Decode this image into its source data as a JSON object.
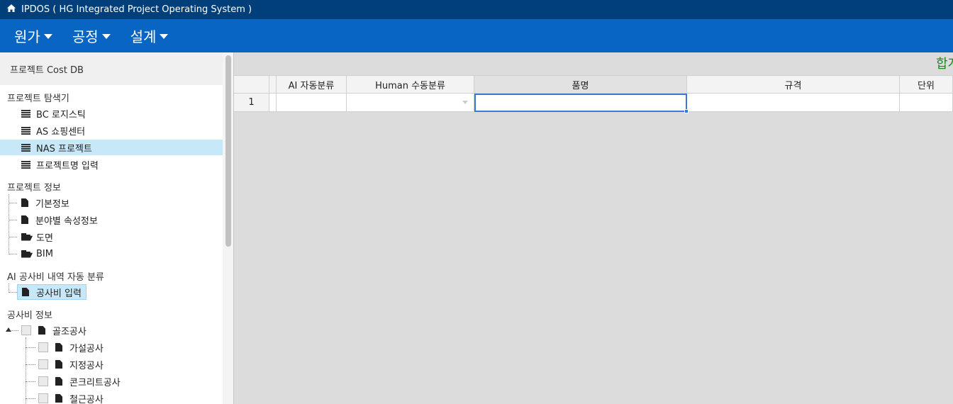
{
  "app": {
    "title": "IPDOS ( HG Integrated Project Operating System )"
  },
  "menu": [
    {
      "label": "원가"
    },
    {
      "label": "공정"
    },
    {
      "label": "설계"
    }
  ],
  "sidebar": {
    "header": "프로젝트 Cost DB",
    "sections": {
      "explorer": "프로젝트 탐색기",
      "info": "프로젝트 정보",
      "ai": "AI 공사비 내역 자동 분류",
      "cost": "공사비 정보"
    },
    "projects": [
      {
        "label": " BC 로지스틱"
      },
      {
        "label": "AS 쇼핑센터"
      },
      {
        "label": "NAS 프로젝트"
      },
      {
        "label": "프로젝트명 입력"
      }
    ],
    "info_items": [
      {
        "label": "기본정보"
      },
      {
        "label": "분야별 속성정보"
      },
      {
        "label": "도면"
      },
      {
        "label": "BIM"
      }
    ],
    "ai_items": [
      {
        "label": "공사비 입력"
      }
    ],
    "cost_root": {
      "label": "골조공사"
    },
    "cost_children": [
      {
        "label": "가설공사"
      },
      {
        "label": "지정공사"
      },
      {
        "label": "콘크리트공사"
      },
      {
        "label": "철근공사"
      }
    ]
  },
  "main": {
    "sum_label": "합계",
    "columns": [
      "",
      "AI 자동분류",
      "Human 수동분류",
      "품명",
      "규격",
      "단위"
    ],
    "rows": [
      [
        "1",
        "",
        "",
        "",
        "",
        "",
        ""
      ]
    ]
  }
}
